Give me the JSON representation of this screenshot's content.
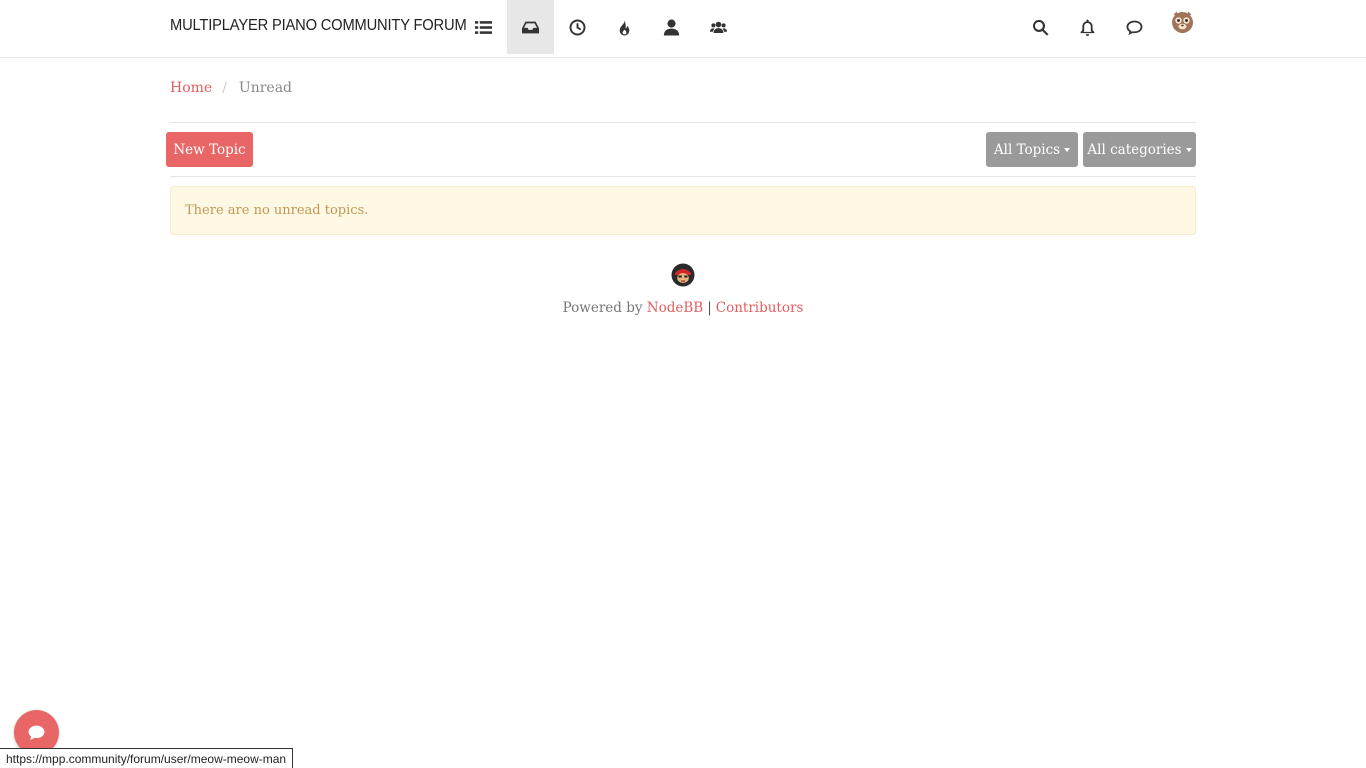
{
  "header": {
    "brand": "MULTIPLAYER PIANO COMMUNITY FORUM",
    "nav_icons": [
      "list-icon",
      "inbox-icon",
      "clock-icon",
      "fire-icon",
      "user-icon",
      "users-icon"
    ],
    "active_nav": "inbox-icon",
    "right_icons": [
      "search-icon",
      "bell-icon",
      "chat-icon"
    ]
  },
  "breadcrumb": {
    "home": "Home",
    "current": "Unread"
  },
  "toolbar": {
    "new_topic": "New Topic",
    "all_topics": "All Topics",
    "all_categories": "All categories"
  },
  "alert": {
    "message": "There are no unread topics."
  },
  "footer": {
    "powered_by": "Powered by",
    "nodebb": "NodeBB",
    "separator": "|",
    "contributors": "Contributors"
  },
  "statusbar": {
    "url": "https://mpp.community/forum/user/meow-meow-man"
  },
  "colors": {
    "accent": "#e86666",
    "link": "#e05f5f",
    "alert_bg": "#fcf8e3",
    "alert_text": "#c09853",
    "button_gray": "#9a9a9a"
  }
}
